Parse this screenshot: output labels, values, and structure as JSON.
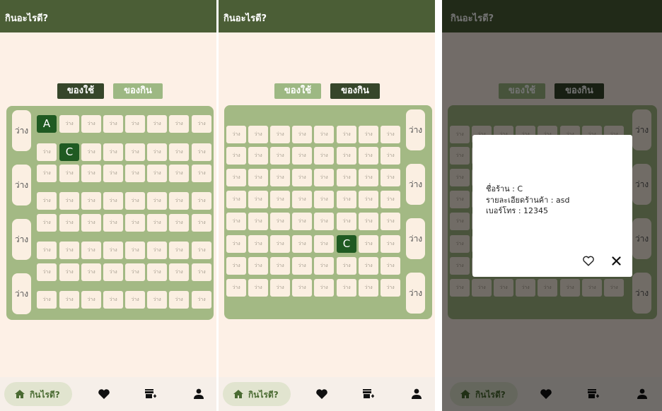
{
  "app_title": "กินอะไรดี?",
  "toggle": {
    "items_label": "ของใช้",
    "food_label": "ของกิน"
  },
  "cell_label": "ว่าง",
  "side_label": "ว่าง",
  "markers": {
    "a": "A",
    "c": "C"
  },
  "nav": {
    "home_label": "กินไรดี?"
  },
  "dialog": {
    "shop_name": "ชื่อร้าน : C",
    "details": "รายละเอียดร้านค้า : asd",
    "phone": "เบอร์โทร : 12345"
  },
  "colors": {
    "appbar": "#4b5e36",
    "board": "#a3b984",
    "selected": "#1f5a22",
    "background": "#fdf0e6"
  }
}
